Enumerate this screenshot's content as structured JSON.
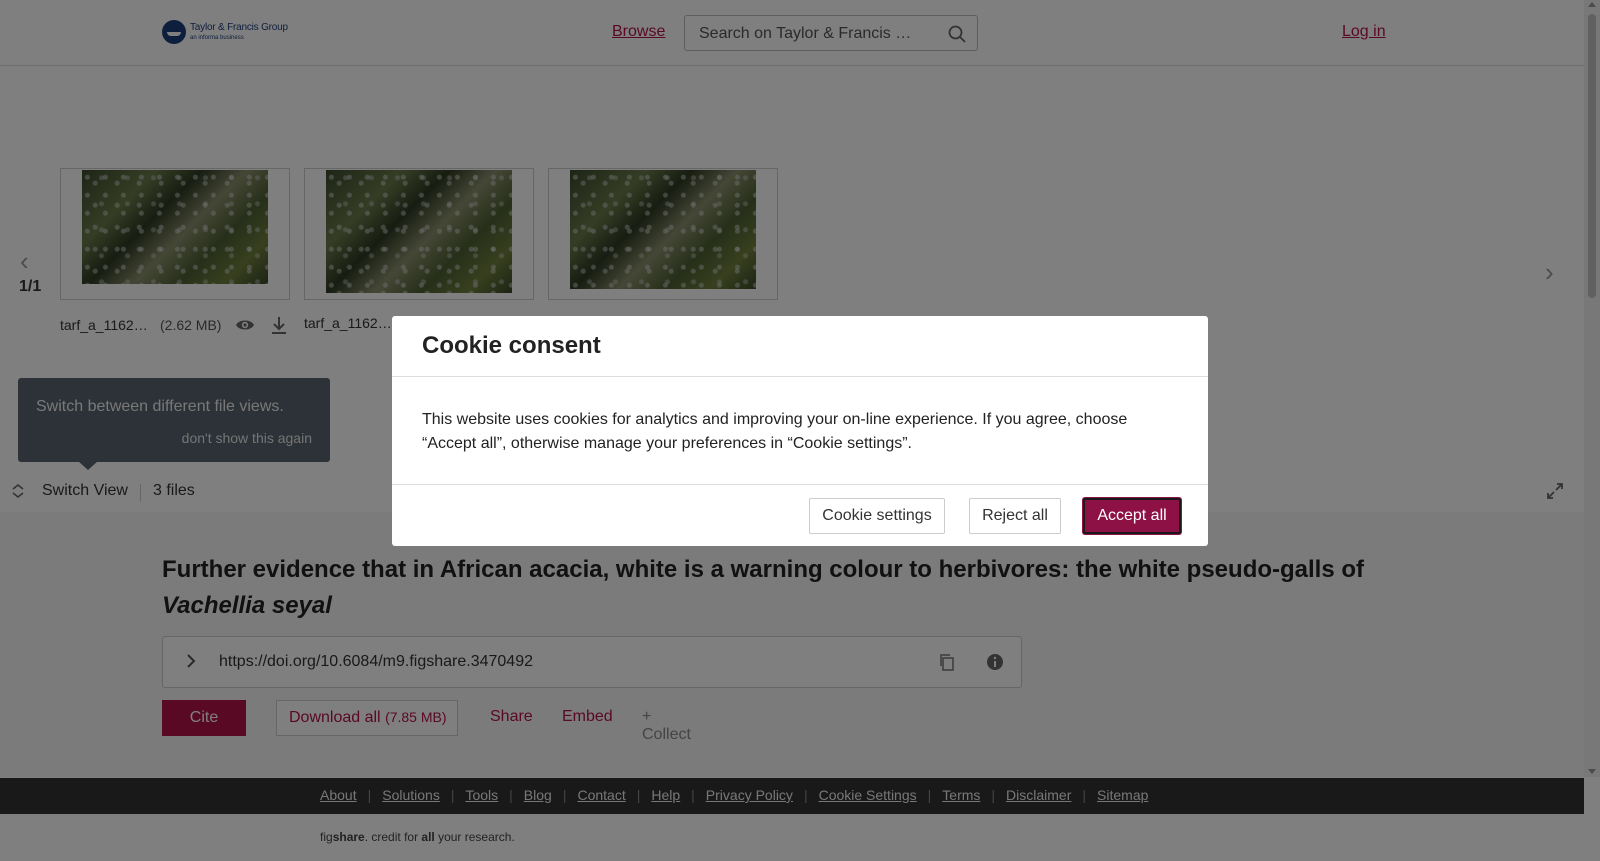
{
  "header": {
    "logo_name": "Taylor & Francis Group",
    "logo_sub": "an informa business",
    "browse": "Browse",
    "search_placeholder": "Search on Taylor & Francis …",
    "login": "Log in"
  },
  "preview": {
    "page_count": "1/1",
    "files": [
      {
        "name": "tarf_a_1162…",
        "size": "(2.62 MB)"
      },
      {
        "name": "tarf_a_1162…"
      },
      {
        "name": ""
      }
    ],
    "tooltip": {
      "text": "Switch between different file views.",
      "dismiss": "don't show this again"
    },
    "switch_view": "Switch View",
    "files_count": "3 files"
  },
  "article": {
    "title_main": "Further evidence that in African acacia, white is a warning colour to herbivores: the white pseudo-galls of ",
    "title_italic": "Vachellia seyal",
    "doi": "https://doi.org/10.6084/m9.figshare.3470492",
    "cite": "Cite",
    "download_all": "Download all",
    "download_size": "(7.85 MB)",
    "share": "Share",
    "embed": "Embed",
    "collect": "+ Collect"
  },
  "footer": {
    "links": [
      "About",
      "Solutions",
      "Tools",
      "Blog",
      "Contact",
      "Help",
      "Privacy Policy",
      "Cookie Settings",
      "Terms",
      "Disclaimer",
      "Sitemap"
    ],
    "credit_pre": "fig",
    "credit_bold": "share",
    "credit_mid": ". credit for ",
    "credit_all": "all",
    "credit_post": " your research."
  },
  "cookie_modal": {
    "title": "Cookie consent",
    "body": "This website uses cookies for analytics and improving your on-line experience. If you agree, choose “Accept all”, otherwise manage your preferences in “Cookie settings”.",
    "settings": "Cookie settings",
    "reject": "Reject all",
    "accept": "Accept all"
  },
  "colors": {
    "brand": "#b5124a",
    "accept_button": "#8e1146",
    "footer_bg": "#333333"
  }
}
